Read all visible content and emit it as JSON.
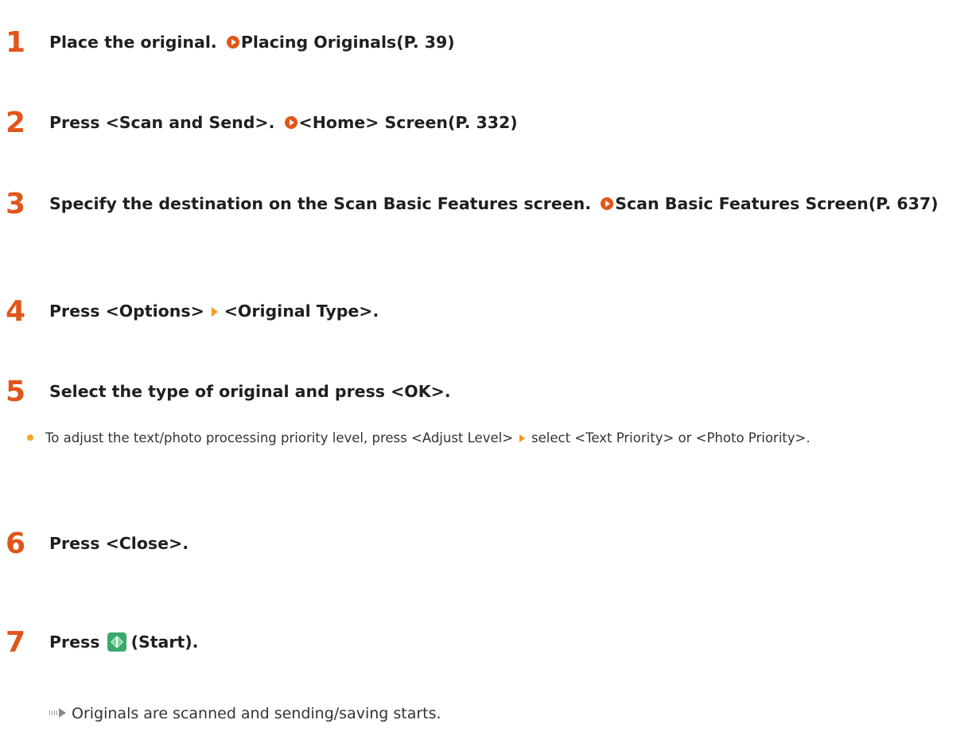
{
  "steps": [
    {
      "num": "1",
      "text": "Place the original.",
      "link": "Placing Originals(P. 39)"
    },
    {
      "num": "2",
      "text": "Press <Scan and Send>.",
      "link": "<Home> Screen(P. 332)"
    },
    {
      "num": "3",
      "text": "Specify the destination on the Scan Basic Features screen.",
      "link": "Scan Basic Features Screen(P. 637)"
    },
    {
      "num": "4",
      "text_before": "Press <Options>",
      "text_after": "<Original Type>."
    },
    {
      "num": "5",
      "text": "Select the type of original and press <OK>."
    },
    {
      "num": "6",
      "text": "Press <Close>."
    },
    {
      "num": "7",
      "text_before": "Press",
      "text_after": "(Start)."
    }
  ],
  "step5_bullet": {
    "text_before": "To adjust the text/photo processing priority level, press <Adjust Level>",
    "text_after": "select <Text Priority> or <Photo Priority>."
  },
  "result": "Originals are scanned and sending/saving starts.",
  "colors": {
    "step_number": "#e0561a",
    "link_icon": "#e0561a",
    "separator_arrow": "#f39a1e",
    "bullet": "#f5a623",
    "start_button": "#3aa86a"
  },
  "icons": {
    "link": "circle-arrow-right-icon",
    "separator": "triangle-right-icon",
    "start": "start-button-icon",
    "result": "result-arrow-icon"
  }
}
